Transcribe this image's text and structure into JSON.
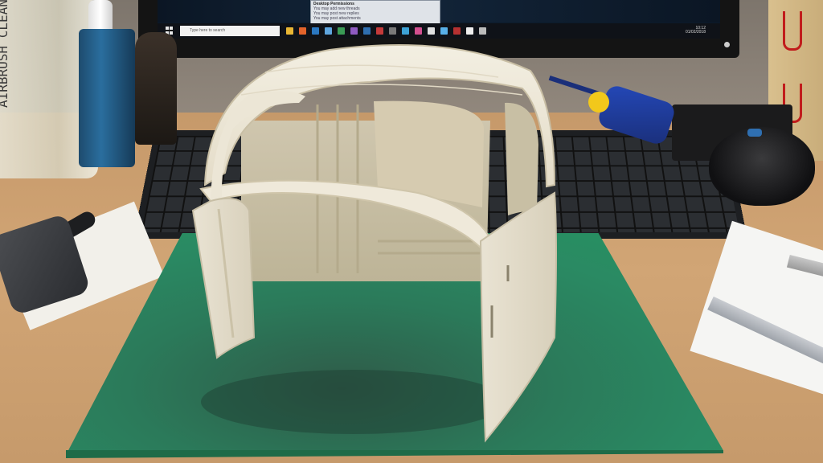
{
  "scene": {
    "description_labels": {
      "bottle_text": "AIRBRUSH CLEANER"
    },
    "screen": {
      "notification_title": "Desktop Permissions",
      "notification_lines": [
        "You may add new threads",
        "You may post new replies",
        "You may post attachments"
      ],
      "search_placeholder": "Type here to search",
      "tray_time": "10:12",
      "tray_date": "01/02/2018"
    }
  },
  "colors": {
    "mat_green": "#2a8a63",
    "model_white": "#f1ede0",
    "desk_wood": "#d1a575",
    "glue_blue": "#2448b8",
    "glue_cap_yellow": "#f2c81b"
  }
}
